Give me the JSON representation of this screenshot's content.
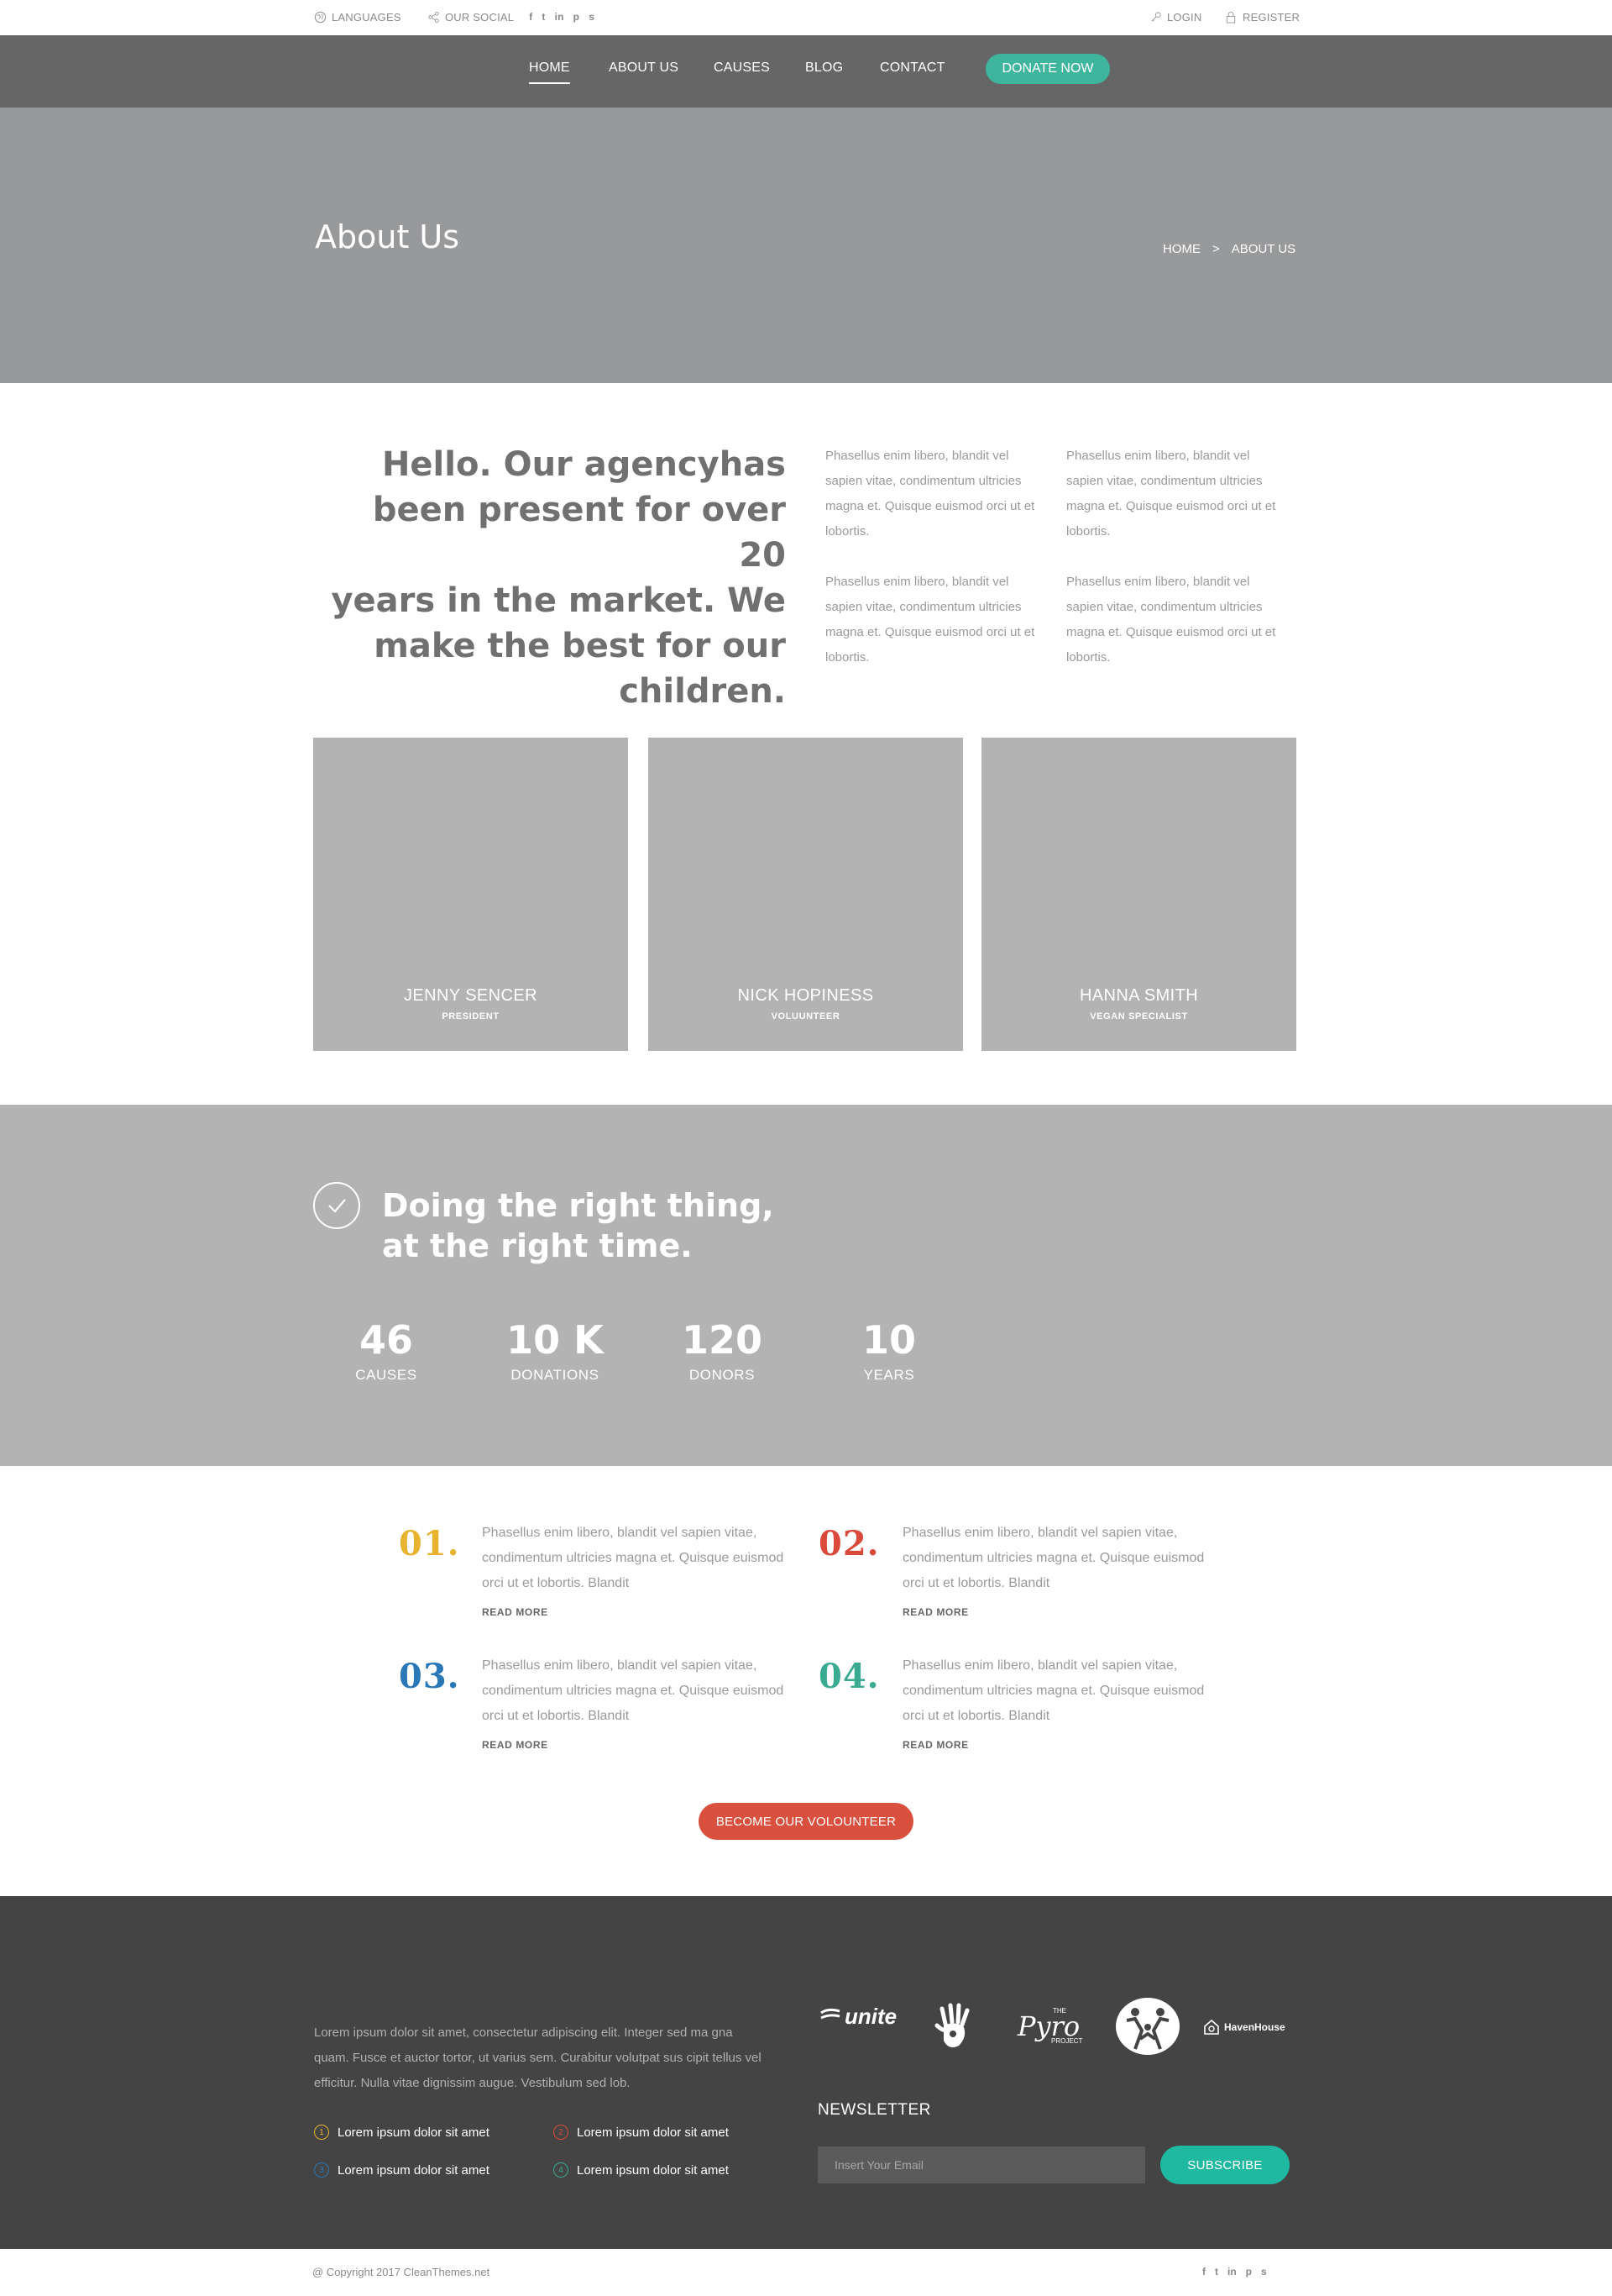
{
  "topbar": {
    "languages": "LANGUAGES",
    "social": "OUR SOCIAL",
    "social_icons": [
      "f",
      "t",
      "in",
      "p",
      "s"
    ],
    "login": "LOGIN",
    "register": "REGISTER"
  },
  "nav": {
    "items": [
      "HOME",
      "ABOUT US",
      "CAUSES",
      "BLOG",
      "CONTACT"
    ],
    "donate": "DONATE NOW"
  },
  "hero": {
    "title": "About Us",
    "crumb_home": "HOME",
    "crumb_sep": ">",
    "crumb_current": "ABOUT US"
  },
  "intro": {
    "heading_lines": [
      "Hello. Our agencyhas",
      "been present for over 20",
      "years in the market. We",
      "make the best for our",
      "children."
    ],
    "paragraph": "Phasellus enim libero, blandit vel sapien vitae, condimentum ultricies magna et. Quisque euismod orci ut et lobortis."
  },
  "team": [
    {
      "name": "JENNY SENCER",
      "role": "PRESIDENT"
    },
    {
      "name": "NICK HOPINESS",
      "role": "VOLUUNTEER"
    },
    {
      "name": "HANNA SMITH",
      "role": "VEGAN SPECIALIST"
    }
  ],
  "stats": {
    "heading_1": "Doing the right thing,",
    "heading_2": "at the right time.",
    "items": [
      {
        "num": "46",
        "label": "CAUSES"
      },
      {
        "num": "10 K",
        "label": "DONATIONS"
      },
      {
        "num": "120",
        "label": "DONORS"
      },
      {
        "num": "10",
        "label": "YEARS"
      }
    ]
  },
  "steps": {
    "items": [
      {
        "num": "01.",
        "color": "#e8b430"
      },
      {
        "num": "02.",
        "color": "#d94a3a"
      },
      {
        "num": "03.",
        "color": "#2a78b8"
      },
      {
        "num": "04.",
        "color": "#3aab92"
      }
    ],
    "text": "Phasellus enim libero, blandit vel sapien vitae, condimentum ultricies magna et. Quisque euismod orci ut et lobortis. Blandit",
    "read_more": "READ MORE",
    "volunteer": "BECOME OUR VOLOUNTEER"
  },
  "footer": {
    "paragraph": "Lorem ipsum dolor sit amet, consectetur adipiscing elit. Integer sed ma gna quam. Fusce et auctor tortor, ut varius sem. Curabitur volutpat sus cipit tellus vel efficitur. Nulla vitae dignissim augue. Vestibulum sed lob.",
    "list": [
      {
        "n": "1",
        "text": "Lorem ipsum dolor sit amet",
        "color": "#e8b430"
      },
      {
        "n": "2",
        "text": "Lorem ipsum dolor sit amet",
        "color": "#d94a3a"
      },
      {
        "n": "3",
        "text": "Lorem ipsum dolor sit amet",
        "color": "#2a78b8"
      },
      {
        "n": "4",
        "text": "Lorem ipsum dolor sit amet",
        "color": "#3aab92"
      }
    ],
    "logos": {
      "unite": "unite",
      "pyro_the": "THE",
      "pyro_name": "Pyro",
      "pyro_project": "PROJECT",
      "haven": "HavenHouse"
    },
    "newsletter": "NEWSLETTER",
    "email_placeholder": "Insert Your Email",
    "subscribe": "SUBSCRIBE",
    "copyright": "@ Copyright 2017 CleanThemes.net"
  }
}
